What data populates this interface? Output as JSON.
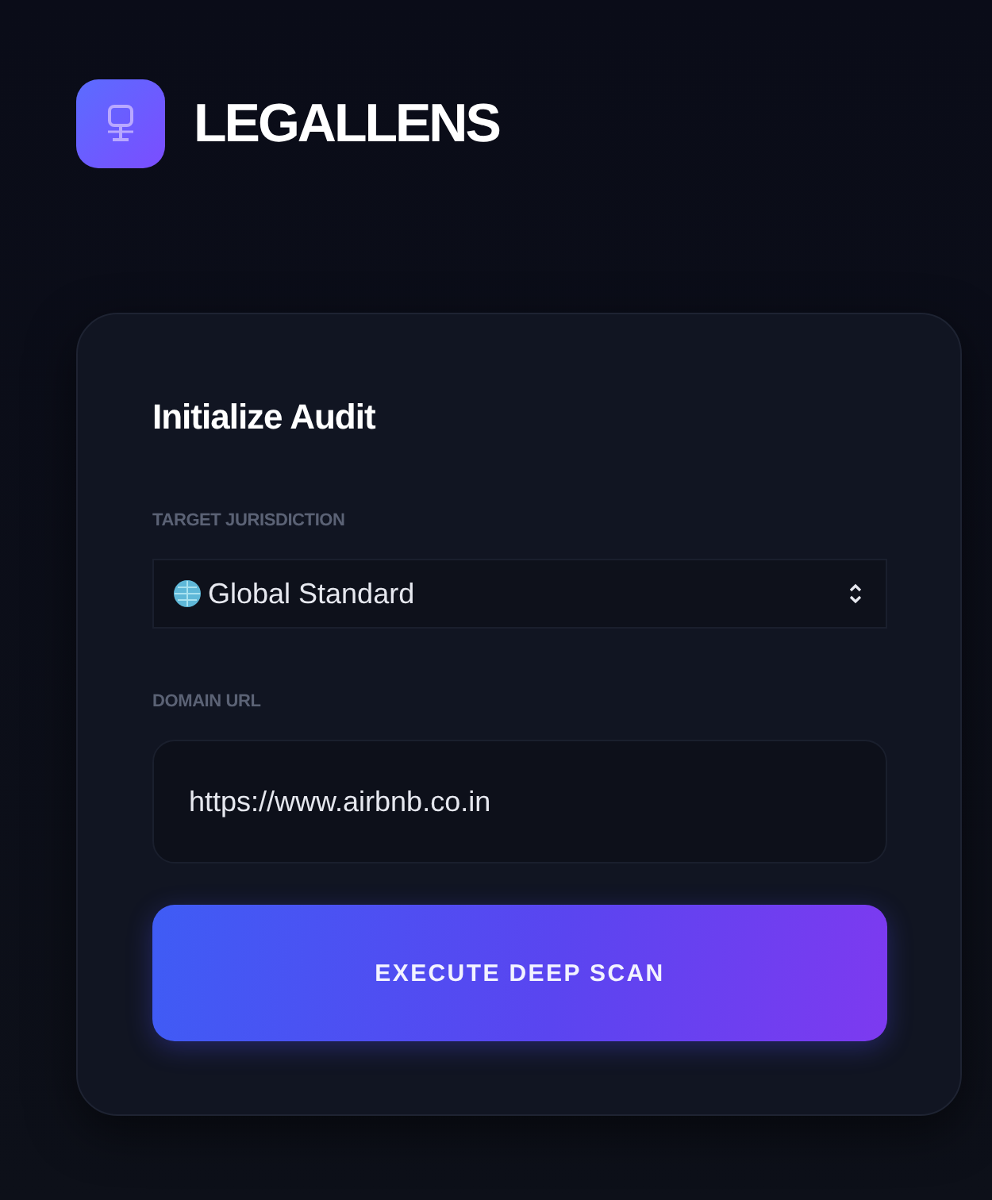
{
  "brand": {
    "name": "LEGALLENS"
  },
  "form": {
    "title": "Initialize Audit",
    "jurisdiction": {
      "label": "TARGET JURISDICTION",
      "value": "Global Standard"
    },
    "domain": {
      "label": "DOMAIN URL",
      "value": "https://www.airbnb.co.in"
    },
    "submit": "EXECUTE DEEP SCAN"
  }
}
